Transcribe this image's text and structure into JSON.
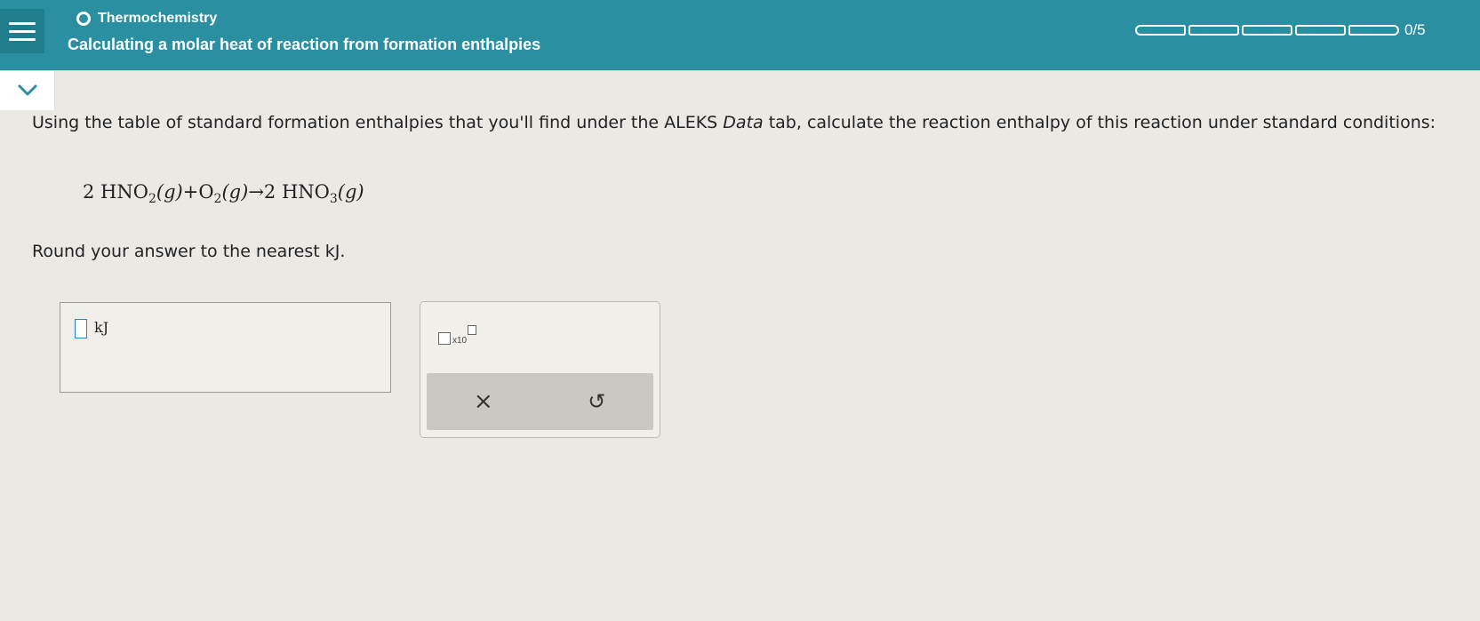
{
  "header": {
    "topic": "Thermochemistry",
    "title": "Calculating a molar heat of reaction from formation enthalpies",
    "progress_text": "0/5",
    "progress_segments": 5,
    "progress_completed": 0,
    "bg_color": "#2a8fa0"
  },
  "question": {
    "intro_before": "Using the table of standard formation enthalpies that you'll find under the ALEKS ",
    "intro_italic": "Data",
    "intro_after": " tab, calculate the reaction enthalpy of this reaction under standard conditions:",
    "equation": {
      "reactant1_coef": "2 HNO",
      "reactant1_sub": "2",
      "reactant1_phase": "(g)",
      "plus": "+",
      "reactant2": "O",
      "reactant2_sub": "2",
      "reactant2_phase": "(g)",
      "arrow": "→",
      "product_coef": "2 HNO",
      "product_sub": "3",
      "product_phase": "(g)"
    },
    "rounding": "Round your answer to the nearest kJ."
  },
  "answer": {
    "value": "",
    "unit": "kJ"
  },
  "tools": {
    "sci_notation_label": "x10",
    "clear_icon": "×",
    "undo_icon": "↺"
  }
}
